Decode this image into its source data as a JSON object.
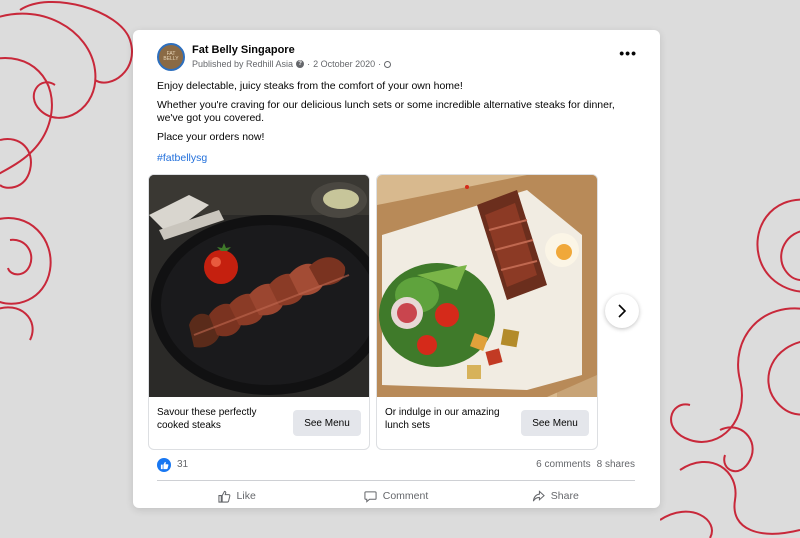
{
  "post": {
    "page_name": "Fat Belly Singapore",
    "published_by": "Published by Redhill Asia",
    "date": "2 October 2020",
    "separator": "·",
    "avatar_text": "FAT BELLY",
    "more_label": "•••",
    "paragraphs": [
      "Enjoy delectable, juicy steaks from the comfort of your own home!",
      "Whether you're craving for our delicious lunch sets or some incredible alternative steaks for dinner, we've got you covered.",
      "Place your orders now!"
    ],
    "hashtag": "#fatbellysg"
  },
  "carousel": [
    {
      "caption": "Savour these perfectly cooked steaks",
      "button": "See Menu",
      "image": "steak-on-plate"
    },
    {
      "caption": "Or indulge in our amazing lunch sets",
      "button": "See Menu",
      "image": "steak-rice-box"
    }
  ],
  "stats": {
    "likes": "31",
    "comments": "6 comments",
    "shares": "8 shares"
  },
  "actions": {
    "like": "Like",
    "comment": "Comment",
    "share": "Share"
  },
  "icons": [
    "like-icon",
    "comment-icon",
    "share-icon",
    "chevron-right-icon",
    "globe-icon",
    "help-icon",
    "more-icon"
  ],
  "colors": {
    "accent": "#1877f2",
    "hashtag": "#216fdb",
    "ornament": "#c8283a"
  }
}
